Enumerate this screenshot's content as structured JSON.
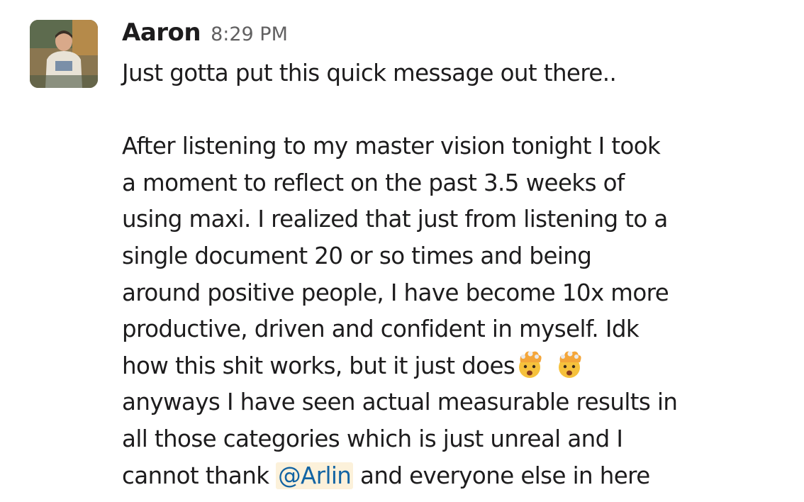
{
  "message": {
    "sender": "Aaron",
    "timestamp": "8:29 PM",
    "line1": "Just gotta put this quick message out there..",
    "line2": "After listening to my master vision tonight I took",
    "line3": "a moment to reflect on the past 3.5 weeks of",
    "line4": "using maxi. I realized that just from listening to a",
    "line5": "single document 20 or so times and being",
    "line6": "around positive people, I have become 10x more",
    "line7": "productive, driven and confident in myself. Idk",
    "line8": "how this shit works, but it just does",
    "line9": "anyways I have seen actual measurable results in",
    "line10": "all those categories which is just unreal and I",
    "line11_before": "cannot thank ",
    "mention": "@Arlin",
    "line11_after": " and everyone else in here",
    "emoji_1": "exploding-head-emoji",
    "emoji_2": "exploding-head-emoji"
  },
  "colors": {
    "text": "#1d1c1d",
    "timestamp": "#616061",
    "mention_text": "#1264a3",
    "mention_bg": "#fcf1da"
  }
}
